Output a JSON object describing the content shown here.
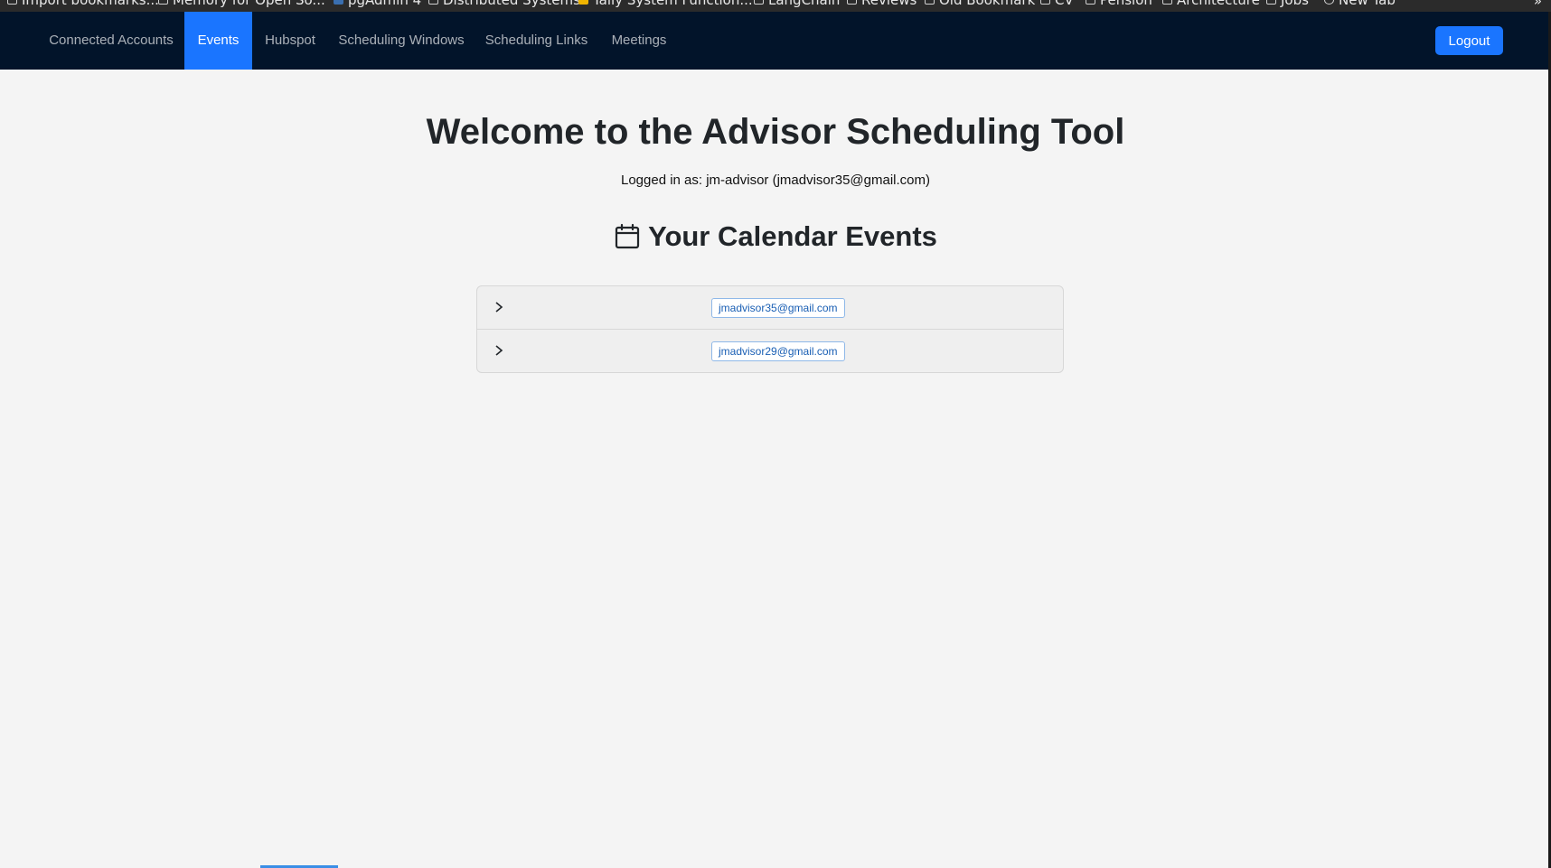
{
  "browser": {
    "bookmarks": [
      {
        "label": "Import bookmarks...",
        "icon": "import-icon"
      },
      {
        "label": "Memory for Open So...",
        "icon": "github-icon"
      },
      {
        "label": "pgAdmin 4",
        "icon": "pgadmin-icon"
      },
      {
        "label": "Distributed Systems",
        "icon": "folder-icon"
      },
      {
        "label": "Tally System Function...",
        "icon": "tally-icon"
      },
      {
        "label": "LangChain",
        "icon": "folder-icon"
      },
      {
        "label": "Reviews",
        "icon": "folder-icon"
      },
      {
        "label": "Old Bookmark",
        "icon": "folder-icon"
      },
      {
        "label": "CV",
        "icon": "folder-icon"
      },
      {
        "label": "Pension",
        "icon": "folder-icon"
      },
      {
        "label": "Architecture",
        "icon": "folder-icon"
      },
      {
        "label": "Jobs",
        "icon": "folder-icon"
      },
      {
        "label": "New Tab",
        "icon": "globe-icon"
      }
    ],
    "overflow": "»"
  },
  "nav": {
    "items": [
      {
        "label": "Connected Accounts",
        "active": false
      },
      {
        "label": "Events",
        "active": true
      },
      {
        "label": "Hubspot",
        "active": false
      },
      {
        "label": "Scheduling Windows",
        "active": false
      },
      {
        "label": "Scheduling Links",
        "active": false
      },
      {
        "label": "Meetings",
        "active": false
      }
    ],
    "logout_label": "Logout"
  },
  "main": {
    "title": "Welcome to the Advisor Scheduling Tool",
    "logged_in": "Logged in as: jm-advisor (jmadvisor35@gmail.com)",
    "section_title": "Your Calendar Events",
    "section_icon": "calendar-icon",
    "accounts": [
      {
        "email": "jmadvisor35@gmail.com"
      },
      {
        "email": "jmadvisor29@gmail.com"
      }
    ]
  },
  "colors": {
    "navbar_bg": "#02142a",
    "accent": "#1a75ff",
    "page_bg": "#f4f4f4",
    "badge_text": "#1a5fb4"
  }
}
